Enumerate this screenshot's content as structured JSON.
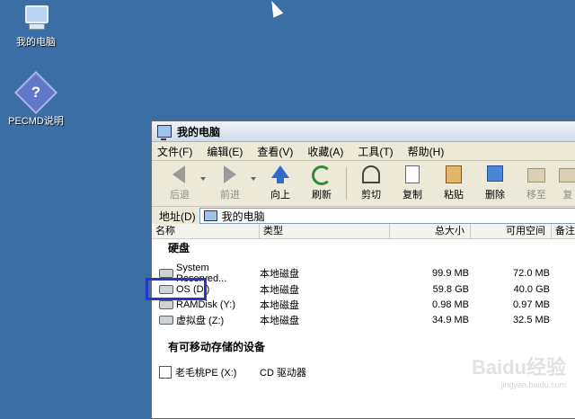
{
  "desktop": {
    "icons": [
      {
        "label": "我的电脑"
      },
      {
        "label": "PECMD说明"
      }
    ]
  },
  "window": {
    "title": "我的电脑",
    "menus": [
      "文件(F)",
      "编辑(E)",
      "查看(V)",
      "收藏(A)",
      "工具(T)",
      "帮助(H)"
    ],
    "toolbar": {
      "back": "后退",
      "forward": "前进",
      "up": "向上",
      "refresh": "刷新",
      "cut": "剪切",
      "copy": "复制",
      "paste": "粘贴",
      "delete": "删除",
      "move": "移至",
      "copyto": "复"
    },
    "address": {
      "label": "地址(D)",
      "value": "我的电脑"
    },
    "columns": [
      "名称",
      "类型",
      "总大小",
      "可用空间",
      "备注"
    ],
    "groups": [
      {
        "title": "硬盘",
        "items": [
          {
            "name": "System Reserved...",
            "type": "本地磁盘",
            "total": "99.9 MB",
            "free": "72.0 MB"
          },
          {
            "name": "OS (D:)",
            "type": "本地磁盘",
            "total": "59.8 GB",
            "free": "40.0 GB"
          },
          {
            "name": "RAMDisk (Y:)",
            "type": "本地磁盘",
            "total": "0.98 MB",
            "free": "0.97 MB"
          },
          {
            "name": "虚拟盘 (Z:)",
            "type": "本地磁盘",
            "total": "34.9 MB",
            "free": "32.5 MB"
          }
        ]
      },
      {
        "title": "有可移动存储的设备",
        "items": [
          {
            "name": "老毛桃PE (X:)",
            "type": "CD 驱动器",
            "total": "",
            "free": ""
          }
        ]
      }
    ]
  },
  "watermark": {
    "text": "Baidu经验",
    "url": "jingyan.baidu.com"
  }
}
